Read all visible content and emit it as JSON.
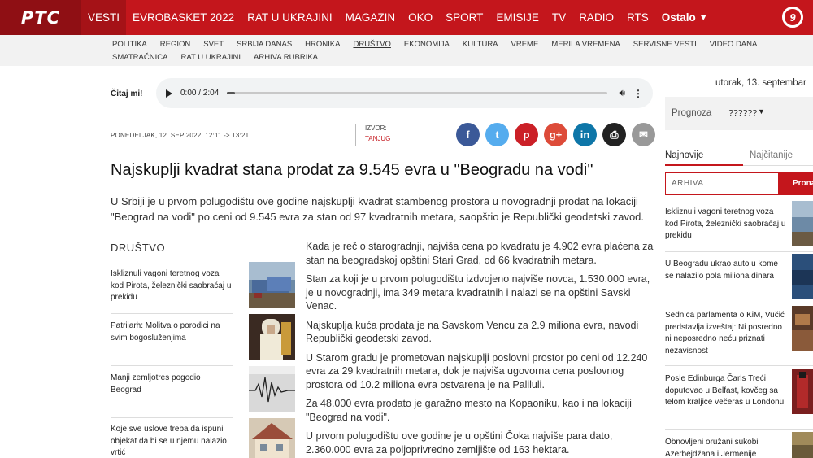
{
  "nav": {
    "logo": "РТС",
    "items": [
      "VESTI",
      "EVROBASKET 2022",
      "RAT U UKRAJINI",
      "MAGAZIN",
      "OKO",
      "SPORT",
      "EMISIJE",
      "TV",
      "RADIO",
      "RTS"
    ],
    "more": "Ostalo",
    "badge": "9"
  },
  "subnav": [
    "POLITIKA",
    "REGION",
    "SVET",
    "SRBIJA DANAS",
    "HRONIKA",
    "DRUŠTVO",
    "EKONOMIJA",
    "KULTURA",
    "VREME",
    "MERILA VREMENA",
    "SERVISNE VESTI",
    "VIDEO DANA",
    "SMATRAČNICA",
    "RAT U UKRAJINI",
    "ARHIVA RUBRIKA"
  ],
  "audio": {
    "label": "Čitaj mi!",
    "time": "0:00 / 2:04",
    "progress": 0.02
  },
  "meta": {
    "date": "PONEDELJAK, 12. SEP 2022, 12:11 -> 13:21",
    "source_label": "IZVOR:",
    "source": "TANJUG"
  },
  "share": [
    {
      "icon": "facebook-icon",
      "glyph": "f",
      "color": "#3b5998"
    },
    {
      "icon": "twitter-icon",
      "glyph": "t",
      "color": "#55acee"
    },
    {
      "icon": "pinterest-icon",
      "glyph": "p",
      "color": "#cb2027"
    },
    {
      "icon": "google-plus-icon",
      "glyph": "g+",
      "color": "#dd4b39"
    },
    {
      "icon": "linkedin-icon",
      "glyph": "in",
      "color": "#0e76a8"
    },
    {
      "icon": "print-icon",
      "glyph": "⎙",
      "color": "#222222"
    },
    {
      "icon": "email-icon",
      "glyph": "✉",
      "color": "#999999"
    }
  ],
  "article": {
    "title": "Najskuplji kvadrat stana prodat za 9.545 evra u \"Beogradu na vodi\"",
    "lead": "U Srbiji je u prvom polugodištu ove godine najskuplji kvadrat stambenog prostora u novogradnji prodat na lokaciji \"Beograd na vodi\" po ceni od 9.545 evra za stan od 97 kvadratnih metara, saopštio je Republički geodetski zavod.",
    "paragraphs": [
      "Kada je reč o starogradnji, najviša cena po kvadratu je 4.902 evra plaćena za stan na beogradskoj opštini Stari Grad, od 66 kvadratnih metara.",
      "Stan za koji je u prvom polugodištu izdvojeno najviše novca, 1.530.000 evra, je u novogradnji,  ima 349 metara kvadratnih i nalazi se na opštini Savski Venac.",
      "Najskuplja kuća prodata je na Savskom Vencu za 2.9 miliona evra, navodi Republički geodetski zavod.",
      "U Starom gradu je prometovan najskuplji poslovni prostor po ceni od 12.240 evra za 29 kvadratnih metara, dok je najviša ugovorna cena poslovnog prostora od 10.2 miliona evra ostvarena je na Paliluli.",
      "Za 48.000 evra prodato je garažno mesto na Kopaoniku, kao i na lokaciji \"Beograd na vodi\".",
      "U prvom polugodištu ove godine je u opštini Čoka najviše para dato, 2.360.000 evra za poljoprivredno zemljište od 163 hektara."
    ]
  },
  "related": {
    "section": "DRUŠTVO",
    "items": [
      "Iskliznuli vagoni teretnog voza kod Pirota, železnički saobraćaj u prekidu",
      "Patrijarh: Molitva o porodici na svim bogosluženjima",
      "Manji zemljotres pogodio Beograd",
      "Koje sve uslove treba da ispuni objekat da bi se u njemu nalazio vrtić"
    ]
  },
  "sidebar": {
    "date": "utorak, 13. septembar",
    "forecast_label": "Prognoza",
    "forecast_value": "??????",
    "tab_latest": "Najnovije",
    "tab_popular": "Najčitanije",
    "archive_placeholder": "ARHIVA",
    "archive_button": "Pronađi",
    "news": [
      "Iskliznuli vagoni teretnog voza kod Pirota, železnički saobraćaj u prekidu",
      "U Beogradu ukrao auto u kome se nalazilo pola miliona dinara",
      "Sednica parlamenta o KiM, Vučić predstavlja izveštaj: Ni posredno ni neposredno neću priznati nezavisnost",
      "Posle Edinburga Čarls Treći doputovao u Belfast, kovčeg sa telom kraljice večeras u Londonu",
      "Obnovljeni oružani sukobi Azerbejdžana i Jermenije"
    ]
  }
}
